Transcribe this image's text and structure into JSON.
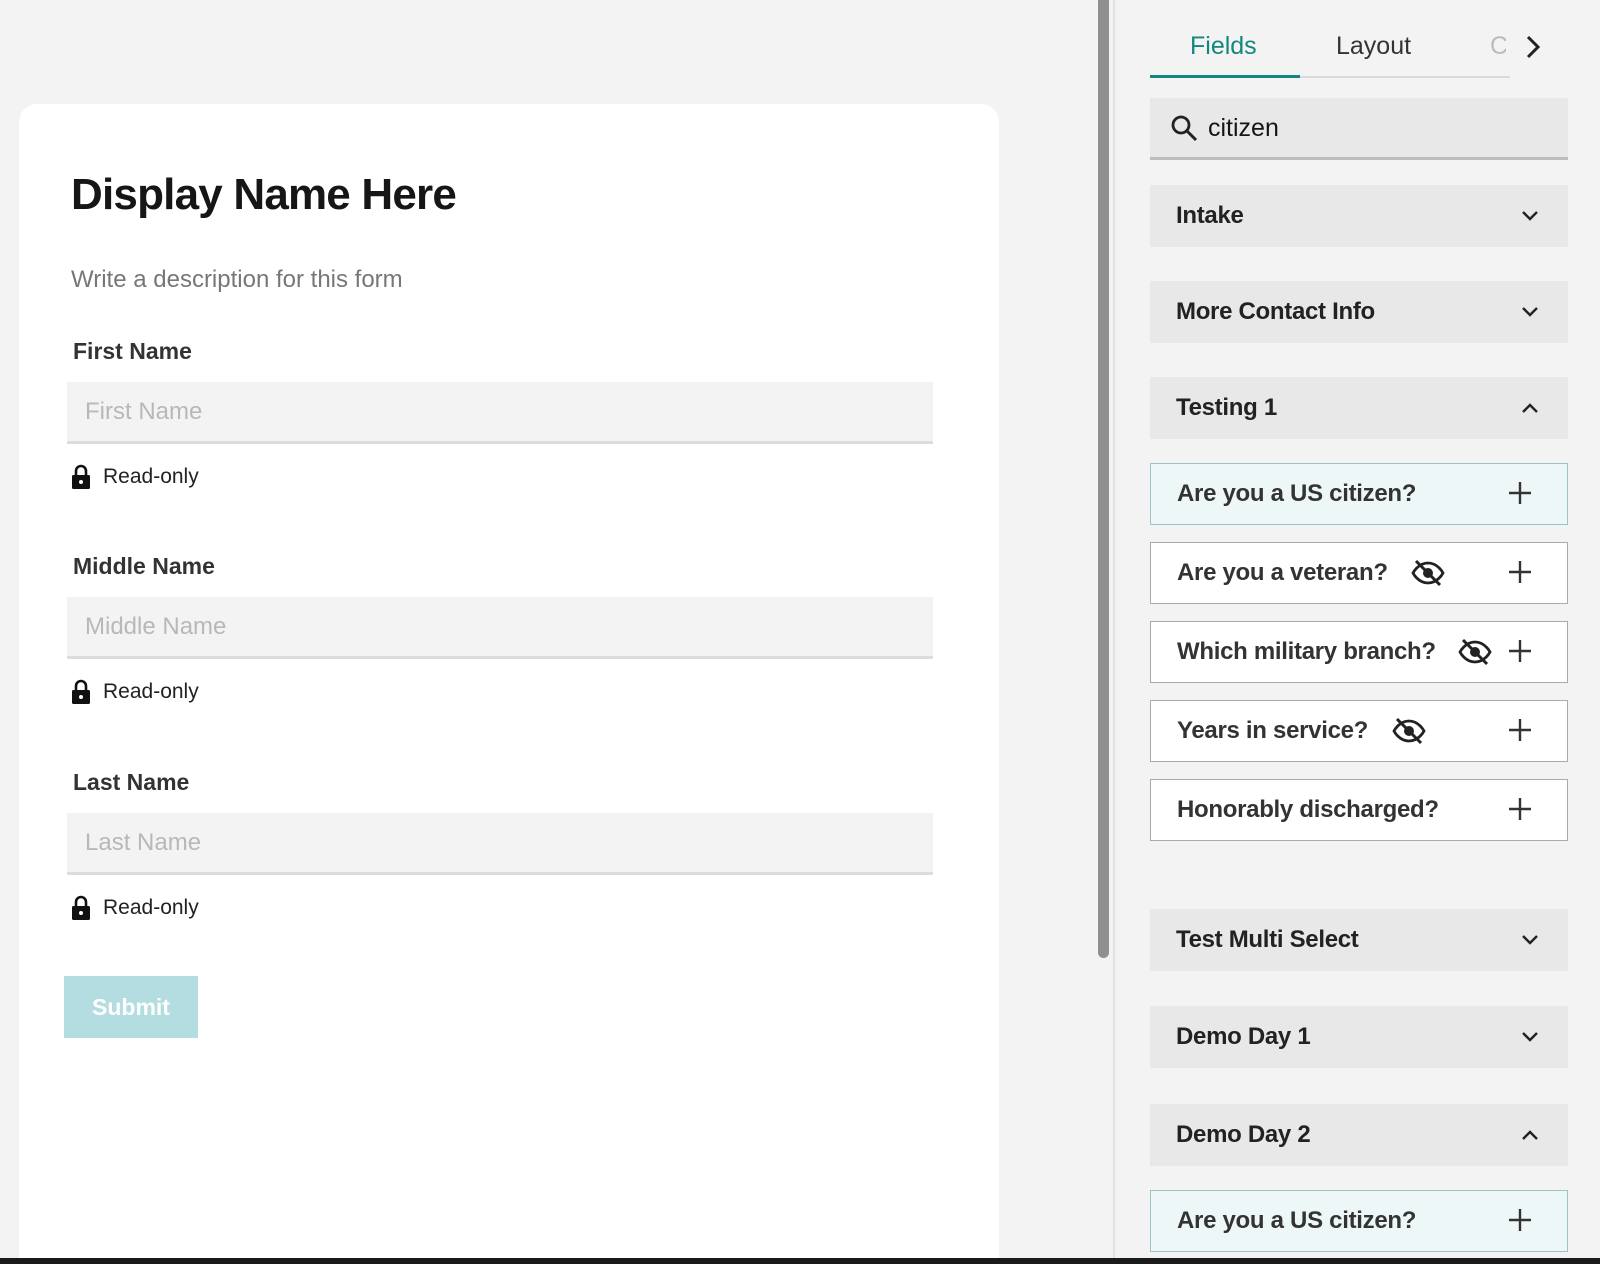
{
  "form": {
    "title": "Display Name Here",
    "description": "Write a description for this form",
    "fields": [
      {
        "label": "First Name",
        "placeholder": "First Name",
        "readonly_label": "Read-only"
      },
      {
        "label": "Middle Name",
        "placeholder": "Middle Name",
        "readonly_label": "Read-only"
      },
      {
        "label": "Last Name",
        "placeholder": "Last Name",
        "readonly_label": "Read-only"
      }
    ],
    "submit_label": "Submit"
  },
  "panel": {
    "tabs": [
      {
        "label": "Fields",
        "active": true
      },
      {
        "label": "Layout",
        "active": false
      },
      {
        "label": "C",
        "active": false
      }
    ],
    "search": {
      "value": "citizen"
    },
    "sections": [
      {
        "label": "Intake",
        "expanded": false
      },
      {
        "label": "More Contact Info",
        "expanded": false
      },
      {
        "label": "Testing 1",
        "expanded": true
      },
      {
        "label": "Test Multi Select",
        "expanded": false
      },
      {
        "label": "Demo Day 1",
        "expanded": false
      },
      {
        "label": "Demo Day 2",
        "expanded": true
      }
    ],
    "items": [
      {
        "label": "Are you a US citizen?",
        "hidden": false,
        "highlighted": true
      },
      {
        "label": "Are you a veteran?",
        "hidden": true,
        "highlighted": false
      },
      {
        "label": "Which military branch?",
        "hidden": true,
        "highlighted": false
      },
      {
        "label": "Years in service?",
        "hidden": true,
        "highlighted": false
      },
      {
        "label": "Honorably discharged?",
        "hidden": false,
        "highlighted": false
      },
      {
        "label": "Are you a US citizen?",
        "hidden": false,
        "highlighted": true
      }
    ]
  },
  "colors": {
    "accent": "#12877f",
    "submit_disabled": "#b3dde0",
    "highlight_bg": "#eef7f8"
  },
  "icons": [
    "search-icon",
    "lock-icon",
    "chevron-down-icon",
    "chevron-up-icon",
    "chevron-right-icon",
    "eye-off-icon",
    "plus-icon"
  ]
}
